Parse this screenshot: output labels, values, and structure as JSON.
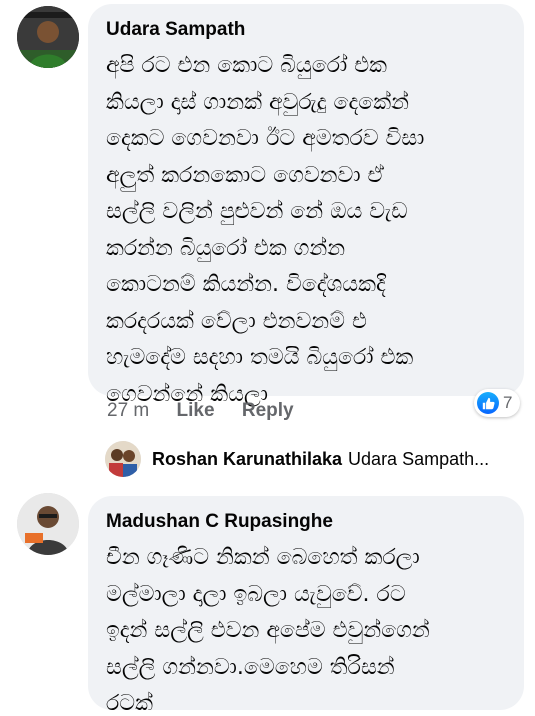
{
  "comments": [
    {
      "author": "Udara Sampath",
      "lines": [
        "අපි රට එන කොට බියුරෝ එක",
        "කියලා දාස් ගානක් අවුරුදු දෙකේන්",
        "දෙකට ගෙවනවා ඊට අමතරව විසා",
        "අලුත් කරනකොට ගෙවනවා ඒ",
        "සල්ලි වලින් පුළුවන් නේ ඔය වැඩ",
        "කරන්න බියුරෝ එක ගන්න",
        "කොටනම් කියන්න. විදේශයකදි",
        "කරදරයක් වේලා එනවනම් එ",
        "හැමදේම  සදහා තමයි බියුරෝ එක",
        "ගෙවන්නේ කියලා"
      ],
      "time": "27 m",
      "like_label": "Like",
      "reply_label": "Reply",
      "reaction_count": "7",
      "reaction_icon": "thumbs-up-icon"
    },
    {
      "author": "Madushan C Rupasinghe",
      "lines": [
        "චීන ගෑණිට නිකන් බෙහෙත් කරලා",
        "මල්මාලා දාලා ඉබලා යැවුවේ. රට",
        "ඉදන් සල්ලි එවන අපේම එවුන්ගෙන්",
        "සල්ලි ගන්නවා.මෙහෙම තිරිසන්",
        "රටක්"
      ]
    }
  ],
  "reply_preview": {
    "author": "Roshan Karunathilaka",
    "text": "Udara Sampath..."
  },
  "colors": {
    "bubble": "#f0f2f5",
    "meta": "#65676b",
    "like_blue": "#0866ff"
  }
}
